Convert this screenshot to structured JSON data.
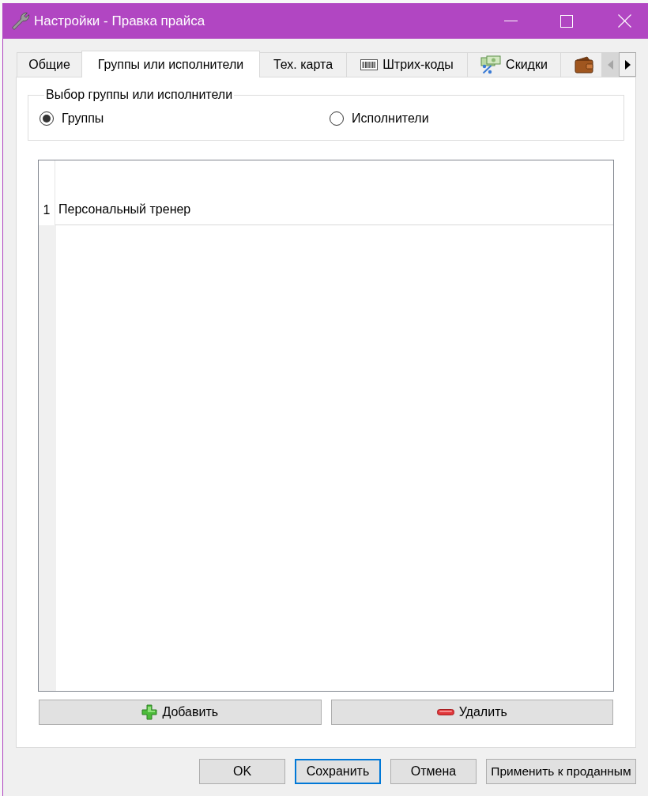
{
  "window": {
    "title": "Настройки - Правка прайса"
  },
  "tabs": [
    {
      "label": "Общие",
      "selected": false,
      "kind": "plain"
    },
    {
      "label": "Группы или исполнители",
      "selected": true,
      "kind": "plain"
    },
    {
      "label": "Тех. карта",
      "selected": false,
      "kind": "plain"
    },
    {
      "label": "Штрих-коды",
      "selected": false,
      "kind": "barcode"
    },
    {
      "label": "Скидки",
      "selected": false,
      "kind": "discount"
    },
    {
      "selected": false,
      "kind": "wallet"
    }
  ],
  "tab_scroller": {
    "back_disabled": true,
    "forward_disabled": false
  },
  "selection_group": {
    "title": "Выбор группы или исполнители",
    "options": [
      {
        "label": "Группы",
        "selected": true
      },
      {
        "label": "Исполнители",
        "selected": false
      }
    ]
  },
  "grid": {
    "rows": [
      {
        "number": "1",
        "text": "Персональный тренер"
      }
    ]
  },
  "grid_buttons": [
    {
      "label": "Добавить",
      "kind": "add"
    },
    {
      "label": "Удалить",
      "kind": "remove"
    }
  ],
  "dialog_buttons": [
    {
      "label": "OK",
      "focused": false
    },
    {
      "label": "Сохранить",
      "focused": true
    },
    {
      "label": "Отмена",
      "focused": false
    },
    {
      "label": "Применить к проданным",
      "focused": false
    }
  ]
}
